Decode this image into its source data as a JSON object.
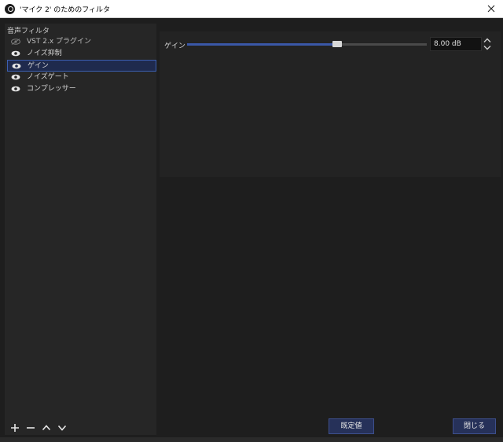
{
  "window": {
    "title": "'マイク 2' のためのフィルタ",
    "close_icon": "close-icon"
  },
  "left_panel": {
    "section_label": "音声フィルタ",
    "filters": [
      {
        "label": "VST 2.x プラグイン",
        "visible": false,
        "selected": false
      },
      {
        "label": "ノイズ抑制",
        "visible": true,
        "selected": false
      },
      {
        "label": "ゲイン",
        "visible": true,
        "selected": true
      },
      {
        "label": "ノイズゲート",
        "visible": true,
        "selected": false
      },
      {
        "label": "コンプレッサー",
        "visible": true,
        "selected": false
      }
    ],
    "toolbar": [
      "add-icon",
      "remove-icon",
      "move-up-icon",
      "move-down-icon"
    ]
  },
  "properties": {
    "gain_label": "ゲイン",
    "gain_value_text": "8.00 dB",
    "gain_slider_fraction": 0.625
  },
  "buttons": {
    "defaults": "既定値",
    "close": "閉じる"
  },
  "colors": {
    "accent": "#3a58a8",
    "selection": "#1f2a4d",
    "background": "#1e1e1e"
  }
}
